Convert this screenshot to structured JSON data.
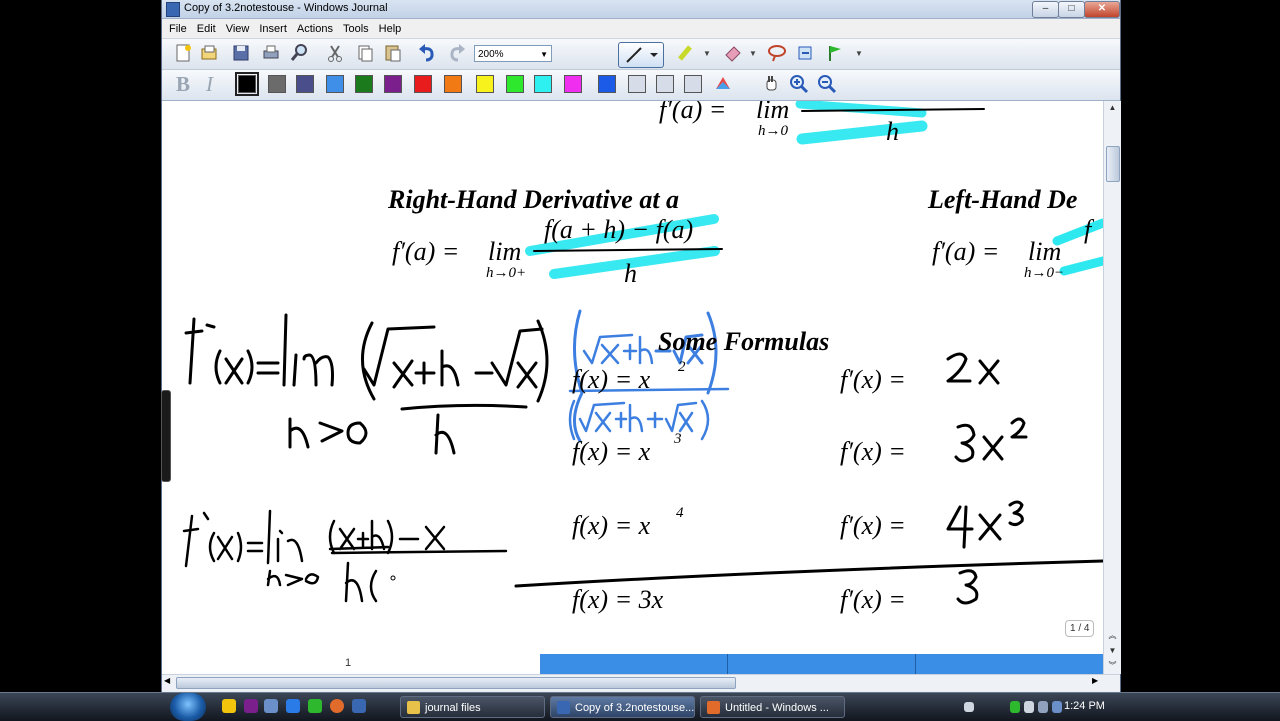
{
  "window": {
    "title": "Copy of 3.2notestouse - Windows Journal"
  },
  "menu": [
    "File",
    "Edit",
    "View",
    "Insert",
    "Actions",
    "Tools",
    "Help"
  ],
  "toolbar": {
    "zoom_value": "200%",
    "buttons": [
      "new-note-icon",
      "open-icon",
      "save-icon",
      "print-icon",
      "search-icon",
      "cut-icon",
      "copy-icon",
      "paste-icon",
      "undo-icon",
      "redo-icon"
    ],
    "pen_buttons": [
      "pen-icon",
      "highlighter-icon",
      "eraser-icon",
      "lasso-icon",
      "insert-space-icon",
      "flag-icon"
    ]
  },
  "format_toolbar": {
    "bold_label": "B",
    "italic_label": "I",
    "colors": [
      "#000000",
      "#6b6b6b",
      "#4a4f8c",
      "#3f8fe8",
      "#1b7a1b",
      "#7a1f8c",
      "#e81c1c",
      "#f27a14",
      "#f7f21c",
      "#2ee82e",
      "#2ef0f0",
      "#ef2ef0",
      "#1c5be8",
      "#d6dde8",
      "#d6dde8",
      "#d6dde8"
    ],
    "selected_color": "#000000",
    "view_buttons": [
      "color-picker-icon",
      "pan-icon",
      "zoom-in-icon",
      "zoom-out-icon"
    ]
  },
  "note": {
    "top_formula": {
      "lhs": "f′(a) =",
      "lim": "lim",
      "sub": "h→0",
      "den": "h"
    },
    "right_heading": "Right-Hand Derivative at a",
    "right_formula": {
      "lhs": "f′(a) =",
      "lim": "lim",
      "sub": "h→0+",
      "num": "f(a + h) − f(a)",
      "den": "h"
    },
    "left_heading": "Left-Hand De",
    "left_formula": {
      "lhs": "f′(a) =",
      "lim": "lim",
      "sub": "h→0−",
      "num": "f"
    },
    "formulas_heading": "Some Formulas",
    "rows": [
      {
        "f": "f(x) = x",
        "exp": "2",
        "fp": "f′(x) =",
        "answer": "2x"
      },
      {
        "f": "f(x) = x",
        "exp": "3",
        "fp": "f′(x) =",
        "answer": "3x²"
      },
      {
        "f": "f(x) = x",
        "exp": "4",
        "fp": "f′(x) =",
        "answer": "4x³"
      },
      {
        "f": "f(x) = 3x",
        "exp": "",
        "fp": "f′(x) =",
        "answer": "3"
      }
    ],
    "page_number": "1",
    "page_count": "1 / 4"
  },
  "taskbar": {
    "tasks": [
      {
        "label": "journal files",
        "icon_color": "#e8c14a"
      },
      {
        "label": "Copy of 3.2notestouse...",
        "icon_color": "#3a67b1"
      },
      {
        "label": "Untitled - Windows ...",
        "icon_color": "#e06b2a"
      }
    ],
    "clock": "1:24 PM"
  }
}
